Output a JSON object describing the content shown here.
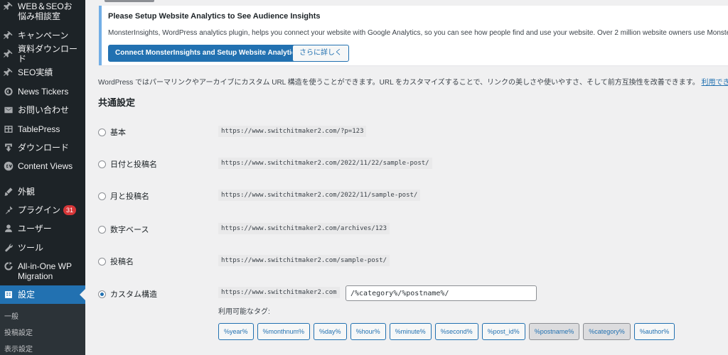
{
  "sidebar": {
    "items": [
      {
        "label": "WEB＆SEOお悩み相談室",
        "icon": "pin-icon"
      },
      {
        "label": "キャンペーン",
        "icon": "pin-icon"
      },
      {
        "label": "資料ダウンロード",
        "icon": "pin-icon"
      },
      {
        "label": "SEO実績",
        "icon": "pin-icon"
      },
      {
        "label": "News Tickers",
        "icon": "ticker-icon"
      },
      {
        "label": "お問い合わせ",
        "icon": "mail-icon"
      },
      {
        "label": "TablePress",
        "icon": "table-icon"
      },
      {
        "label": "ダウンロード",
        "icon": "download-icon"
      },
      {
        "label": "Content Views",
        "icon": "cv-icon"
      },
      {
        "label": "外観",
        "icon": "brush-icon"
      },
      {
        "label": "プラグイン",
        "icon": "plugin-icon",
        "badge": "31"
      },
      {
        "label": "ユーザー",
        "icon": "user-icon"
      },
      {
        "label": "ツール",
        "icon": "wrench-icon"
      },
      {
        "label": "All-in-One WP Migration",
        "icon": "migration-icon"
      },
      {
        "label": "設定",
        "icon": "settings-icon",
        "active": true
      }
    ],
    "submenu": [
      "一般",
      "投稿設定",
      "表示設定"
    ]
  },
  "notice": {
    "title": "Please Setup Website Analytics to See Audience Insights",
    "description": "MonsterInsights, WordPress analytics plugin, helps you connect your website with Google Analytics, so you can see how people find and use your website. Over 2 million website owners use Monster",
    "primary_button": "Connect MonsterInsights and Setup Website Analytics",
    "secondary_button": "さらに詳しく"
  },
  "main": {
    "intro": "WordPress ではパーマリンクやアーカイブにカスタム URL 構造を使うことができます。URL をカスタマイズすることで、リンクの美しさや使いやすさ、そして前方互換性を改善できます。",
    "intro_link": "利用でき",
    "section_title": "共通設定",
    "options": [
      {
        "label": "基本",
        "url": "https://www.switchitmaker2.com/?p=123",
        "checked": false
      },
      {
        "label": "日付と投稿名",
        "url": "https://www.switchitmaker2.com/2022/11/22/sample-post/",
        "checked": false
      },
      {
        "label": "月と投稿名",
        "url": "https://www.switchitmaker2.com/2022/11/sample-post/",
        "checked": false
      },
      {
        "label": "数字ベース",
        "url": "https://www.switchitmaker2.com/archives/123",
        "checked": false
      },
      {
        "label": "投稿名",
        "url": "https://www.switchitmaker2.com/sample-post/",
        "checked": false
      },
      {
        "label": "カスタム構造",
        "url": "https://www.switchitmaker2.com",
        "checked": true
      }
    ],
    "custom_value": "/%category%/%postname%/",
    "tags_label": "利用可能なタグ:",
    "tags": [
      {
        "label": "%year%",
        "active": false
      },
      {
        "label": "%monthnum%",
        "active": false
      },
      {
        "label": "%day%",
        "active": false
      },
      {
        "label": "%hour%",
        "active": false
      },
      {
        "label": "%minute%",
        "active": false
      },
      {
        "label": "%second%",
        "active": false
      },
      {
        "label": "%post_id%",
        "active": false
      },
      {
        "label": "%postname%",
        "active": true
      },
      {
        "label": "%category%",
        "active": true
      },
      {
        "label": "%author%",
        "active": false
      }
    ]
  }
}
